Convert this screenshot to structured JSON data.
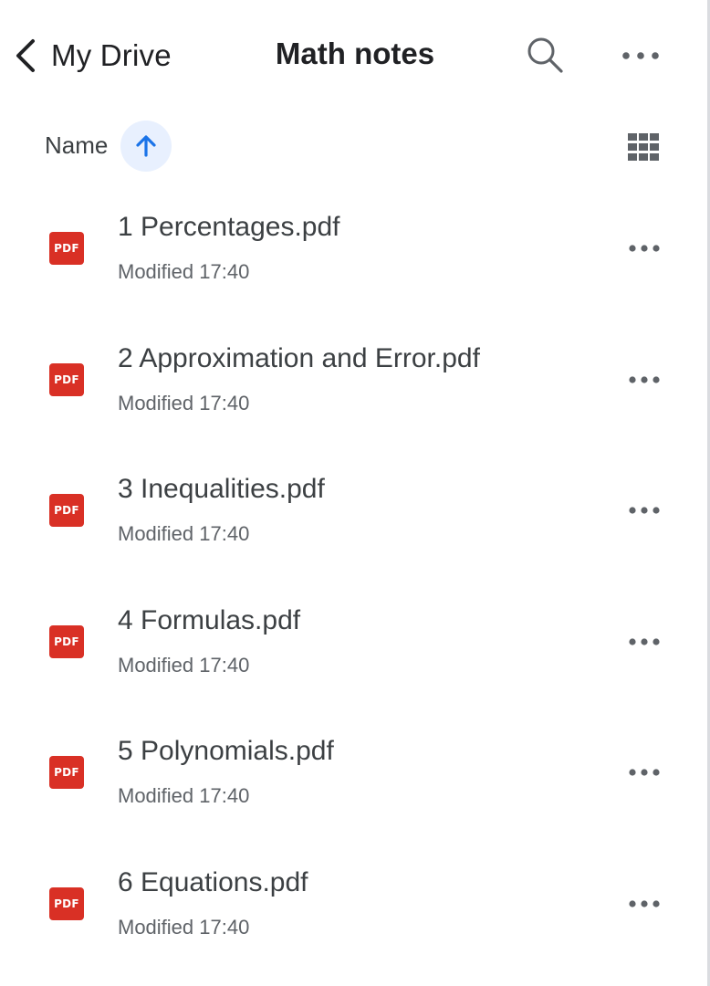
{
  "header": {
    "back_label": "My Drive",
    "title": "Math notes"
  },
  "sort": {
    "label": "Name",
    "direction": "ascending"
  },
  "icons": {
    "back": "chevron-left-icon",
    "search": "search-icon",
    "more": "more-horizontal-icon",
    "sort_direction": "arrow-up-icon",
    "grid_view": "grid-view-icon",
    "file_type": "pdf-file-icon"
  },
  "colors": {
    "pdf_red": "#d93025",
    "accent_blue": "#1a73e8",
    "sort_chip_bg": "#e8f0fe",
    "primary_text": "#202124",
    "secondary_text": "#5f6368"
  },
  "files": [
    {
      "icon_label": "PDF",
      "name": "1 Percentages.pdf",
      "meta": "Modified 17:40"
    },
    {
      "icon_label": "PDF",
      "name": "2 Approximation and Error.pdf",
      "meta": "Modified 17:40"
    },
    {
      "icon_label": "PDF",
      "name": "3 Inequalities.pdf",
      "meta": "Modified 17:40"
    },
    {
      "icon_label": "PDF",
      "name": "4 Formulas.pdf",
      "meta": "Modified 17:40"
    },
    {
      "icon_label": "PDF",
      "name": "5 Polynomials.pdf",
      "meta": "Modified 17:40"
    },
    {
      "icon_label": "PDF",
      "name": "6 Equations.pdf",
      "meta": "Modified 17:40"
    }
  ]
}
